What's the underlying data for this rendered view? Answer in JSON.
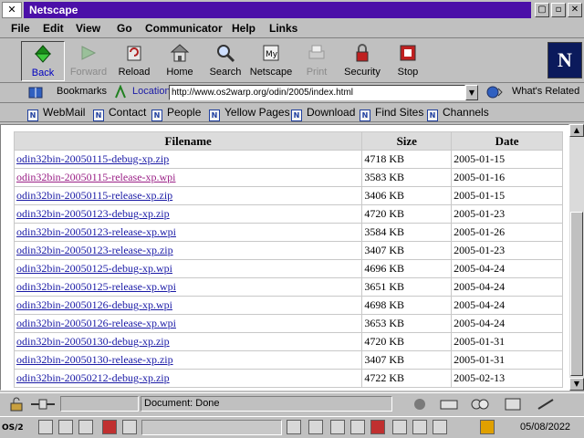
{
  "window": {
    "title": "Netscape"
  },
  "menu": [
    "File",
    "Edit",
    "View",
    "Go",
    "Communicator",
    "Help",
    "Links"
  ],
  "toolbar": {
    "back": "Back",
    "forward": "Forward",
    "reload": "Reload",
    "home": "Home",
    "search": "Search",
    "netscape": "Netscape",
    "print": "Print",
    "security": "Security",
    "stop": "Stop"
  },
  "location": {
    "bookmarks": "Bookmarks",
    "label": "Location:",
    "url": "http://www.os2warp.org/odin/2005/index.html",
    "whats_related": "What's Related"
  },
  "personal": [
    "WebMail",
    "Contact",
    "People",
    "Yellow Pages",
    "Download",
    "Find Sites",
    "Channels"
  ],
  "table": {
    "headers": [
      "Filename",
      "Size",
      "Date"
    ],
    "rows": [
      [
        "odin32bin-20050115-debug-xp.zip",
        "4718 KB",
        "2005-01-15"
      ],
      [
        "odin32bin-20050115-release-xp.wpi",
        "3583 KB",
        "2005-01-16"
      ],
      [
        "odin32bin-20050115-release-xp.zip",
        "3406 KB",
        "2005-01-15"
      ],
      [
        "odin32bin-20050123-debug-xp.zip",
        "4720 KB",
        "2005-01-23"
      ],
      [
        "odin32bin-20050123-release-xp.wpi",
        "3584 KB",
        "2005-01-26"
      ],
      [
        "odin32bin-20050123-release-xp.zip",
        "3407 KB",
        "2005-01-23"
      ],
      [
        "odin32bin-20050125-debug-xp.wpi",
        "4696 KB",
        "2005-04-24"
      ],
      [
        "odin32bin-20050125-release-xp.wpi",
        "3651 KB",
        "2005-04-24"
      ],
      [
        "odin32bin-20050126-debug-xp.wpi",
        "4698 KB",
        "2005-04-24"
      ],
      [
        "odin32bin-20050126-release-xp.wpi",
        "3653 KB",
        "2005-04-24"
      ],
      [
        "odin32bin-20050130-debug-xp.zip",
        "4720 KB",
        "2005-01-31"
      ],
      [
        "odin32bin-20050130-release-xp.zip",
        "3407 KB",
        "2005-01-31"
      ],
      [
        "odin32bin-20050212-debug-xp.zip",
        "4722 KB",
        "2005-02-13"
      ]
    ]
  },
  "status": {
    "text": "Document: Done"
  },
  "taskbar": {
    "clock": "05/08/2022"
  },
  "colors": {
    "title_bar": "#4b0fa8",
    "link": "#1a1aa6",
    "visited_link": "#9a1f86"
  }
}
